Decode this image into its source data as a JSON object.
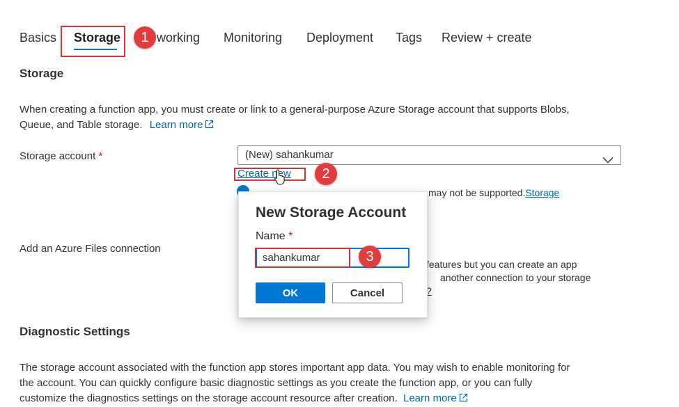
{
  "tabs": [
    {
      "label": "Basics"
    },
    {
      "label": "Storage"
    },
    {
      "label": "working"
    },
    {
      "label": "Monitoring"
    },
    {
      "label": "Deployment"
    },
    {
      "label": "Tags"
    },
    {
      "label": "Review + create"
    }
  ],
  "annotations": [
    "1",
    "2",
    "3"
  ],
  "storage": {
    "heading": "Storage",
    "description_line1": "When creating a function app, you must create or link to a general-purpose Azure Storage account that supports Blobs,",
    "description_line2": "Queue, and Table storage.",
    "learn_more": "Learn more",
    "account_label": "Storage account",
    "required_mark": "*",
    "account_value": "(New) sahankumar",
    "create_new": "Create new",
    "info_text": "may not be supported.",
    "info_link": "Storage"
  },
  "azure_files": {
    "label": "Add an Azure Files connection",
    "text_line1": "features but you can create an app",
    "text_line2": "another connection to your storage",
    "text_line3": "?"
  },
  "dialog": {
    "title": "New Storage Account",
    "name_label": "Name",
    "required_mark": "*",
    "name_value": "sahankumar",
    "ok": "OK",
    "cancel": "Cancel"
  },
  "diagnostics": {
    "heading": "Diagnostic Settings",
    "line1": "The storage account associated with the function app stores important app data. You may wish to enable monitoring for",
    "line2": "the account. You can quickly configure basic diagnostic settings as you create the function app, or you can fully",
    "line3": "customize the diagnostics settings on the storage account resource after creation.",
    "learn_more": "Learn more"
  },
  "colors": {
    "accent": "#0078d4",
    "annotation": "#e23d3d",
    "link": "#0067b8"
  }
}
